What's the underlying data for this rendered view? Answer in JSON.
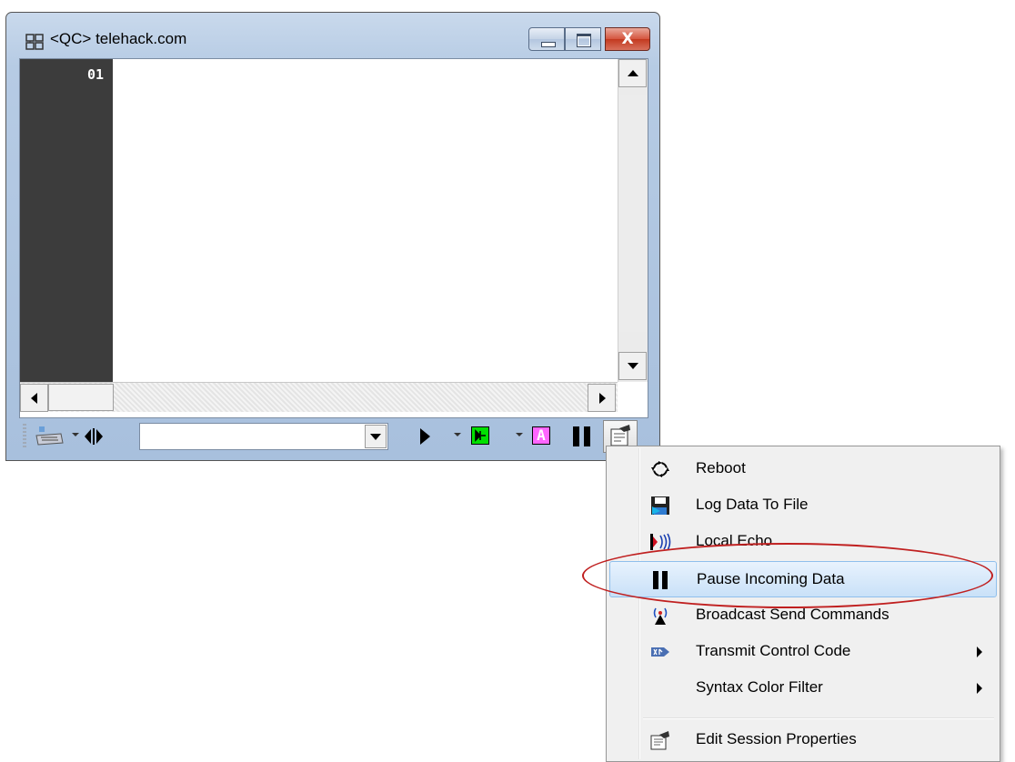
{
  "window": {
    "title": "<QC> telehack.com",
    "close_glyph": "X"
  },
  "editor": {
    "line_numbers": [
      "01"
    ]
  },
  "toolbar": {
    "combo_value": "",
    "icons": [
      "keyboard-icon",
      "dropdown-icon",
      "split-icon",
      "play-icon",
      "green-connect-icon",
      "a-icon",
      "pause-icon",
      "properties-icon"
    ]
  },
  "menu": {
    "items": [
      {
        "label": "Reboot",
        "icon": "reboot-icon"
      },
      {
        "label": "Log Data To File",
        "icon": "floppy-icon"
      },
      {
        "label": "Local Echo",
        "icon": "echo-icon"
      },
      {
        "label": "Pause Incoming Data",
        "icon": "pause-icon",
        "highlighted": true
      },
      {
        "label": "Broadcast Send Commands",
        "icon": "broadcast-icon"
      },
      {
        "label": "Transmit Control Code",
        "icon": "control-code-icon",
        "submenu": true
      },
      {
        "label": "Syntax Color Filter",
        "icon": "",
        "submenu": true
      },
      {
        "label": "Edit Session Properties",
        "icon": "properties-icon"
      }
    ]
  },
  "colors": {
    "gutter": "#3c3c3c",
    "highlight_oval": "#c02020",
    "green_button": "#00e000",
    "magenta_button": "#ff66ff"
  }
}
